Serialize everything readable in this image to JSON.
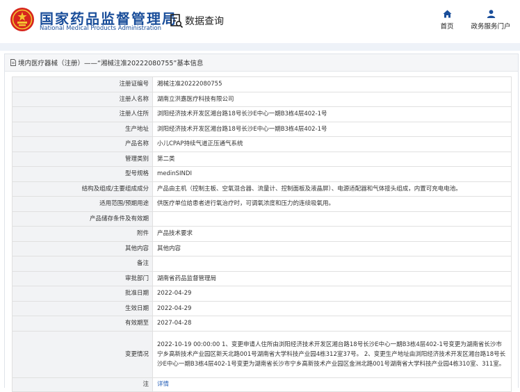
{
  "header": {
    "title": "国家药品监督管理局",
    "subtitle": "National Medical Products Administration",
    "query_label": "数据查询",
    "nav": {
      "home": "首页",
      "service": "政务服务门户"
    }
  },
  "panel": {
    "title": "境内医疗器械（注册）——“湘械注准20222080755”基本信息"
  },
  "rows": [
    {
      "label": "注册证编号",
      "value": "湘械注准20222080755"
    },
    {
      "label": "注册人名称",
      "value": "湖南立洪嘉医疗科技有限公司"
    },
    {
      "label": "注册人住所",
      "value": "浏阳经济技术开发区湘台路18号长沙E中心一期B3栋4层402-1号"
    },
    {
      "label": "生产地址",
      "value": "浏阳经济技术开发区湘台路18号长沙E中心一期B3栋4层402-1号"
    },
    {
      "label": "产品名称",
      "value": "小儿CPAP持续气道正压通气系统"
    },
    {
      "label": "管理类别",
      "value": "第二类"
    },
    {
      "label": "型号规格",
      "value": "medinSINDI"
    },
    {
      "label": "结构及组成/主要组成成分",
      "value": "产品由主机（控制主板、空氧混合器、流量计、控制面板及液晶屏）、电源适配器和气体接头组成，内置可充电电池。"
    },
    {
      "label": "适用范围/预期用途",
      "value": "供医疗单位给患者进行氧治疗时，可调氧浓度和压力的连续吸氧用。"
    },
    {
      "label": "产品储存条件及有效期",
      "value": ""
    },
    {
      "label": "附件",
      "value": "产品技术要求"
    },
    {
      "label": "其他内容",
      "value": "其他内容"
    },
    {
      "label": "备注",
      "value": ""
    },
    {
      "label": "审批部门",
      "value": "湖南省药品监督管理局"
    },
    {
      "label": "批准日期",
      "value": "2022-04-29"
    },
    {
      "label": "生效日期",
      "value": "2022-04-29"
    },
    {
      "label": "有效期至",
      "value": "2027-04-28"
    },
    {
      "label": "变更情况",
      "value": "2022-10-19 00:00:00 1、变更申请人住所由浏阳经济技术开发区湘台路18号长沙E中心一期B3栋4层402-1号变更为湖南省长沙市宁乡高新技术产业园区新天北路001号湖南省大学科技产业园4栋312室37号。 2、变更生产地址由浏阳经济技术开发区湘台路18号长沙E中心一期B3栋4层402-1号变更为湖南省长沙市宁乡高新技术产业园区金洲北路001号湖南省大学科技产业园4栋310室、311室。"
    },
    {
      "label": "注",
      "value": "详情"
    }
  ],
  "colors": {
    "brand_blue": "#1a4e9a",
    "emblem_red": "#d7261d",
    "emblem_gold": "#f4c531",
    "link_blue": "#2a62b8"
  }
}
